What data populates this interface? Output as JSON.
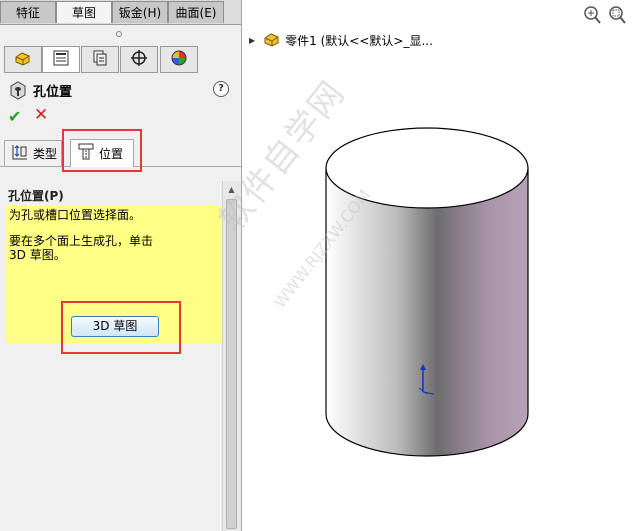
{
  "command_manager": {
    "tabs": [
      {
        "label": "特征",
        "active": false
      },
      {
        "label": "草图",
        "active": true
      },
      {
        "label": "钣金(H)",
        "active": false
      },
      {
        "label": "曲面(E)",
        "active": false
      }
    ]
  },
  "manager_tabs": [
    {
      "icon": "feature-manager-icon",
      "active": false
    },
    {
      "icon": "property-manager-icon",
      "active": true
    },
    {
      "icon": "configuration-manager-icon",
      "active": false
    },
    {
      "icon": "dimxpert-manager-icon",
      "active": false
    },
    {
      "icon": "display-manager-icon",
      "active": false
    }
  ],
  "property_manager": {
    "title": "孔位置",
    "sub_tabs": [
      {
        "label": "类型",
        "icon": "type-icon",
        "active": false
      },
      {
        "label": "位置",
        "icon": "position-icon",
        "active": true
      }
    ],
    "group_title": "孔位置(P)",
    "message_lines": [
      "为孔或槽口位置选择面。",
      "要在多个面上生成孔，单击",
      "3D 草图。"
    ],
    "sketch3d_button": "3D 草图"
  },
  "viewport": {
    "tree_label": "零件1  (默认<<默认>_显..."
  },
  "watermark": {
    "text": "软件自学网",
    "url": "WWW.RJZXW.COM"
  },
  "colors": {
    "highlight": "#e53935",
    "message_bg": "#ffff86",
    "ok": "#2d9a2d",
    "cancel": "#d42020"
  }
}
